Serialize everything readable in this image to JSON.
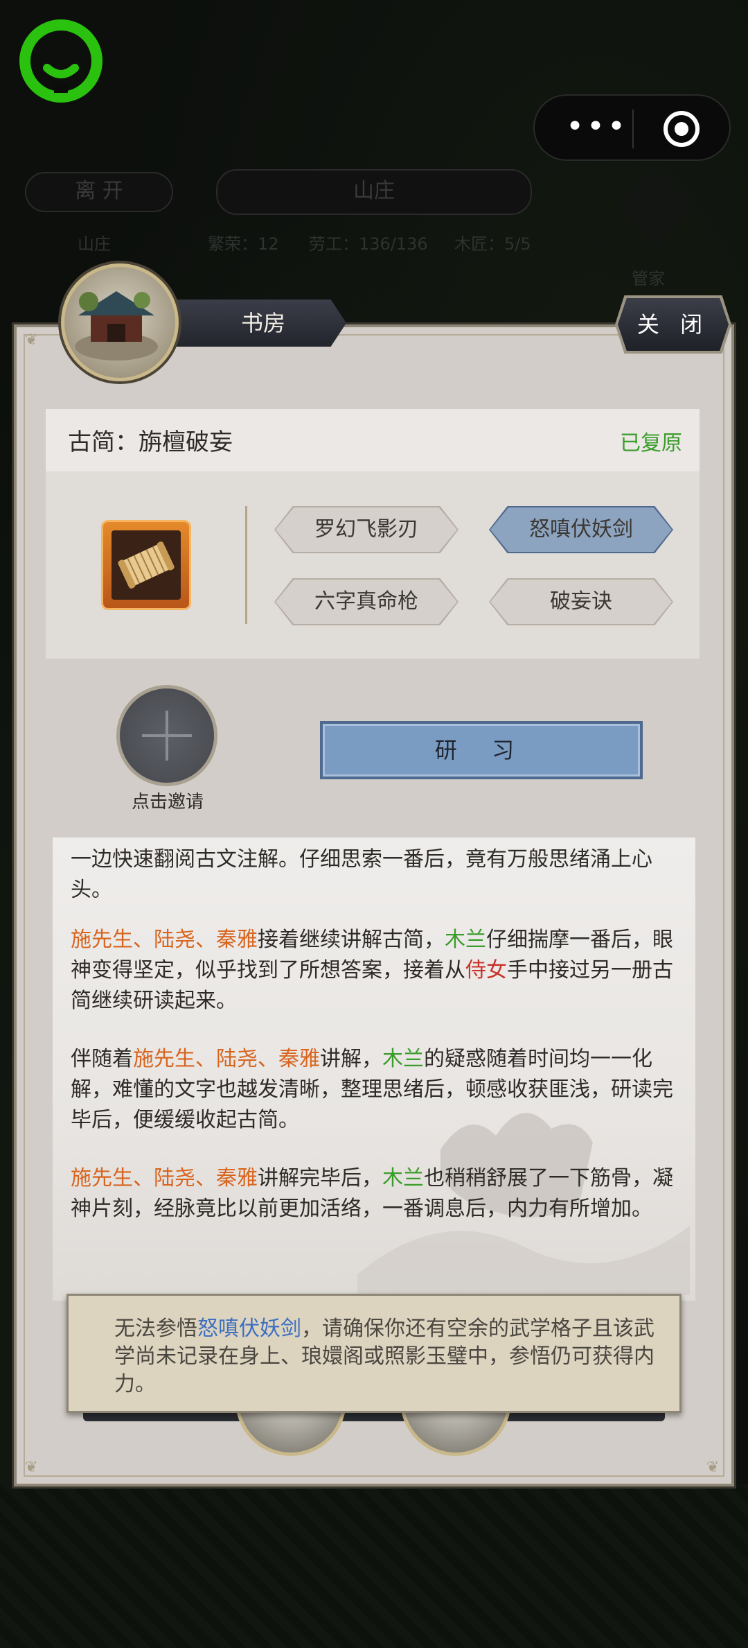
{
  "top": {
    "leave_label": "离 开",
    "location_label": "山庄",
    "sub_label": "山庄",
    "stats": [
      "繁荣：12",
      "劳工：136/136",
      "木匠：5/5"
    ],
    "manager_label": "管家"
  },
  "panel": {
    "title": "书房",
    "close_label": "关 闭",
    "scroll": {
      "title": "古简：旃檀破妄",
      "status": "已复原",
      "status_color": "#3a9c2a",
      "skills": [
        {
          "label": "罗幻飞影刃",
          "selected": false
        },
        {
          "label": "怒嗔伏妖剑",
          "selected": true
        },
        {
          "label": "六字真命枪",
          "selected": false
        },
        {
          "label": "破妄诀",
          "selected": false
        }
      ]
    },
    "invite_label": "点击邀请",
    "study_label": "研 习"
  },
  "log": {
    "p1": {
      "text": "一边快速翻阅古文注解。仔细思索一番后，竟有万般思绪涌上心头。"
    },
    "p2": {
      "names": "施先生、陆尧、秦雅",
      "t1": "接着继续讲解古简，",
      "hero": "木兰",
      "t2": "仔细揣摩一番后，眼神变得坚定，似乎找到了所想答案，接着从",
      "maid": "侍女",
      "t3": "手中接过另一册古简继续研读起来。"
    },
    "p3": {
      "t0": "伴随着",
      "names": "施先生、陆尧、秦雅",
      "t1": "讲解，",
      "hero": "木兰",
      "t2": "的疑惑随着时间均一一化解，难懂的文字也越发清晰，整理思绪后，顿感收获匪浅，研读完毕后，便缓缓收起古简。"
    },
    "p4": {
      "names": "施先生、陆尧、秦雅",
      "t1": "讲解完毕后，",
      "hero": "木兰",
      "t2": "也稍稍舒展了一下筋骨，凝神片刻，经脉竟比以前更加活络，一番调息后，内力有所增加。"
    }
  },
  "notice": {
    "t1": "无法参悟",
    "skill": "怒嗔伏妖剑",
    "t2": "，请确保你还有空余的武学格子且该武学尚未记录在身上、琅嬛阁或照影玉璧中，参悟仍可获得内力。"
  },
  "colors": {
    "name_orange": "#d8641e",
    "hero_green": "#3a9c2a",
    "maid_red": "#c8322a",
    "skill_blue": "#3d6fc2",
    "button_blue": "#7b9cc2"
  },
  "icons": [
    "miniapp-logo-icon",
    "more-dots-icon",
    "target-icon",
    "scroll-item-icon",
    "plus-icon",
    "building-icon"
  ]
}
